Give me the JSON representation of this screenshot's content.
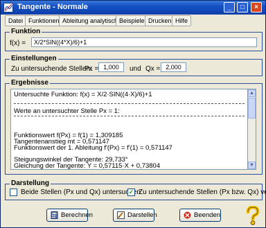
{
  "window": {
    "title": "Tangente - Normale"
  },
  "menu": [
    "Datei",
    "Funktionen",
    "Ableitung analytisch",
    "Beispiele",
    "Drucken",
    "Hilfe"
  ],
  "funktion": {
    "legend": "Funktion",
    "label": "f(x) =",
    "value": "X/2*SIN((4*X)/6)+1"
  },
  "einstellungen": {
    "legend": "Einstellungen",
    "label": "Zu untersuchende Stellen:",
    "px_label": "Px =",
    "px_value": "1,000",
    "und": "und",
    "qx_label": "Qx =",
    "qx_value": "2,000"
  },
  "ergebnisse": {
    "legend": "Ergebnisse",
    "lines": [
      "Untersuchte Funktion: f(x) = X/2·SIN((4·X)/6)+1",
      "Werte an untersuchter Stelle Px = 1:",
      "Funktionswert f(Px) = f(1) = 1,309185",
      "Tangentenanstieg mt = 0,571147",
      "Funktionswert der 1. Ableitung f'(Px) = f'(1) = 0,571147",
      "Steigungswinkel der Tangente: 29,733°",
      "Gleichung der Tangente: Y = 0,57115·X + 0,73804"
    ]
  },
  "darstellung": {
    "legend": "Darstellung",
    "option1": {
      "label": "Beide Stellen (Px und Qx) untersuchen",
      "checked": false
    },
    "option2": {
      "label": "Zu untersuchende Stellen (Px bzw. Qx) verw.",
      "checked": true
    }
  },
  "buttons": {
    "berechnen": "Berechnen",
    "darstellen": "Darstellen",
    "beenden": "Beenden"
  },
  "colors": {
    "titlebar": "#1450c4",
    "group_border": "#2a4f9c",
    "window_bg": "#ece9d8"
  },
  "icons": {
    "app": "tangent-graph-icon",
    "berechnen": "calculator-icon",
    "darstellen": "pencil-icon",
    "beenden": "close-x-icon",
    "help": "question-mark-icon"
  }
}
